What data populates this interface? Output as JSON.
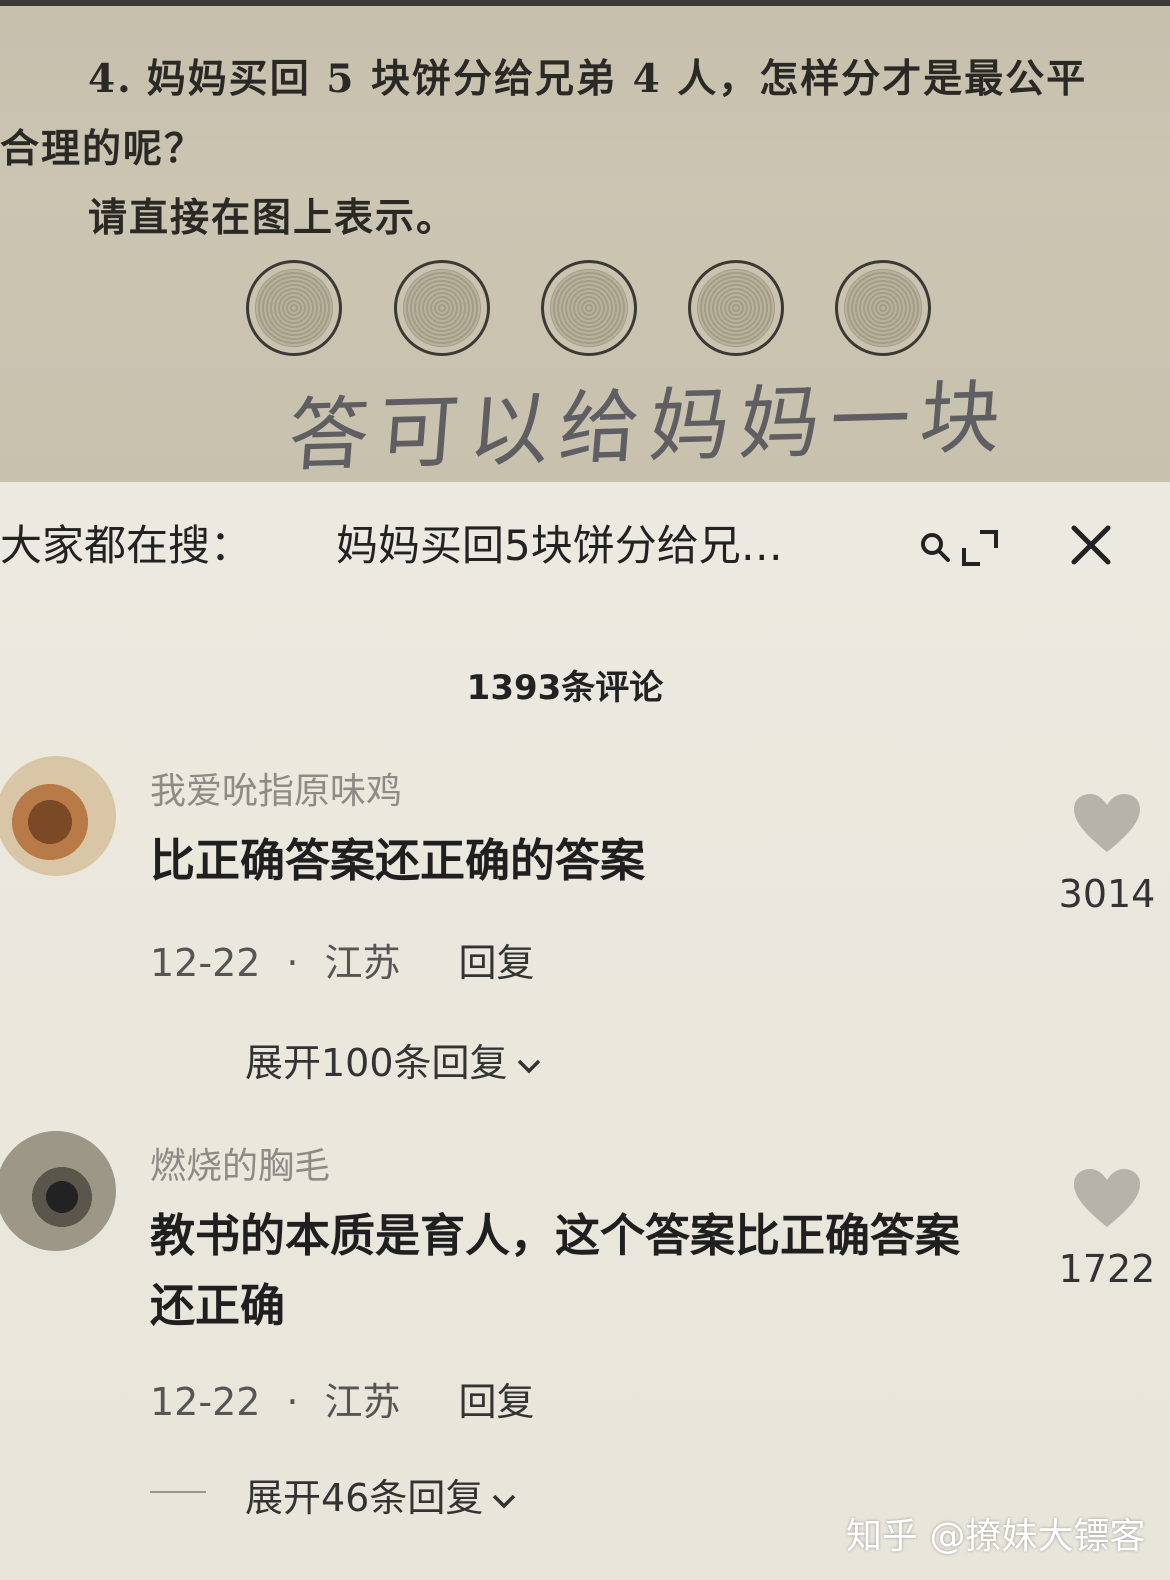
{
  "textbook": {
    "number": "4.",
    "line1": "妈妈买回 5 块饼分给兄弟 4 人，怎样分才是最公平",
    "line2": "合理的呢？",
    "line3": "请直接在图上表示。",
    "handwritten_answer": "答可以给妈妈一块"
  },
  "search": {
    "prefix": "大家都在搜：",
    "query": "妈妈买回5块饼分给兄…"
  },
  "comments_header": "1393条评论",
  "comments": [
    {
      "username": "我爱吮指原味鸡",
      "text": "比正确答案还正确的答案",
      "date": "12-22",
      "separator": "·",
      "location": "江苏",
      "reply_label": "回复",
      "likes": "3014",
      "expand_label": "展开100条回复"
    },
    {
      "username": "燃烧的胸毛",
      "text": "教书的本质是育人，这个答案比正确答案还正确",
      "date": "12-22",
      "separator": "·",
      "location": "江苏",
      "reply_label": "回复",
      "likes": "1722",
      "expand_label": "展开46条回复"
    }
  ],
  "watermark": "知乎 @撩妹大镖客",
  "colors": {
    "sheet_background": "#eceae0",
    "photo_background": "#c7c1ae",
    "username": "#8d8b84",
    "heart": "#b5b3aa"
  }
}
